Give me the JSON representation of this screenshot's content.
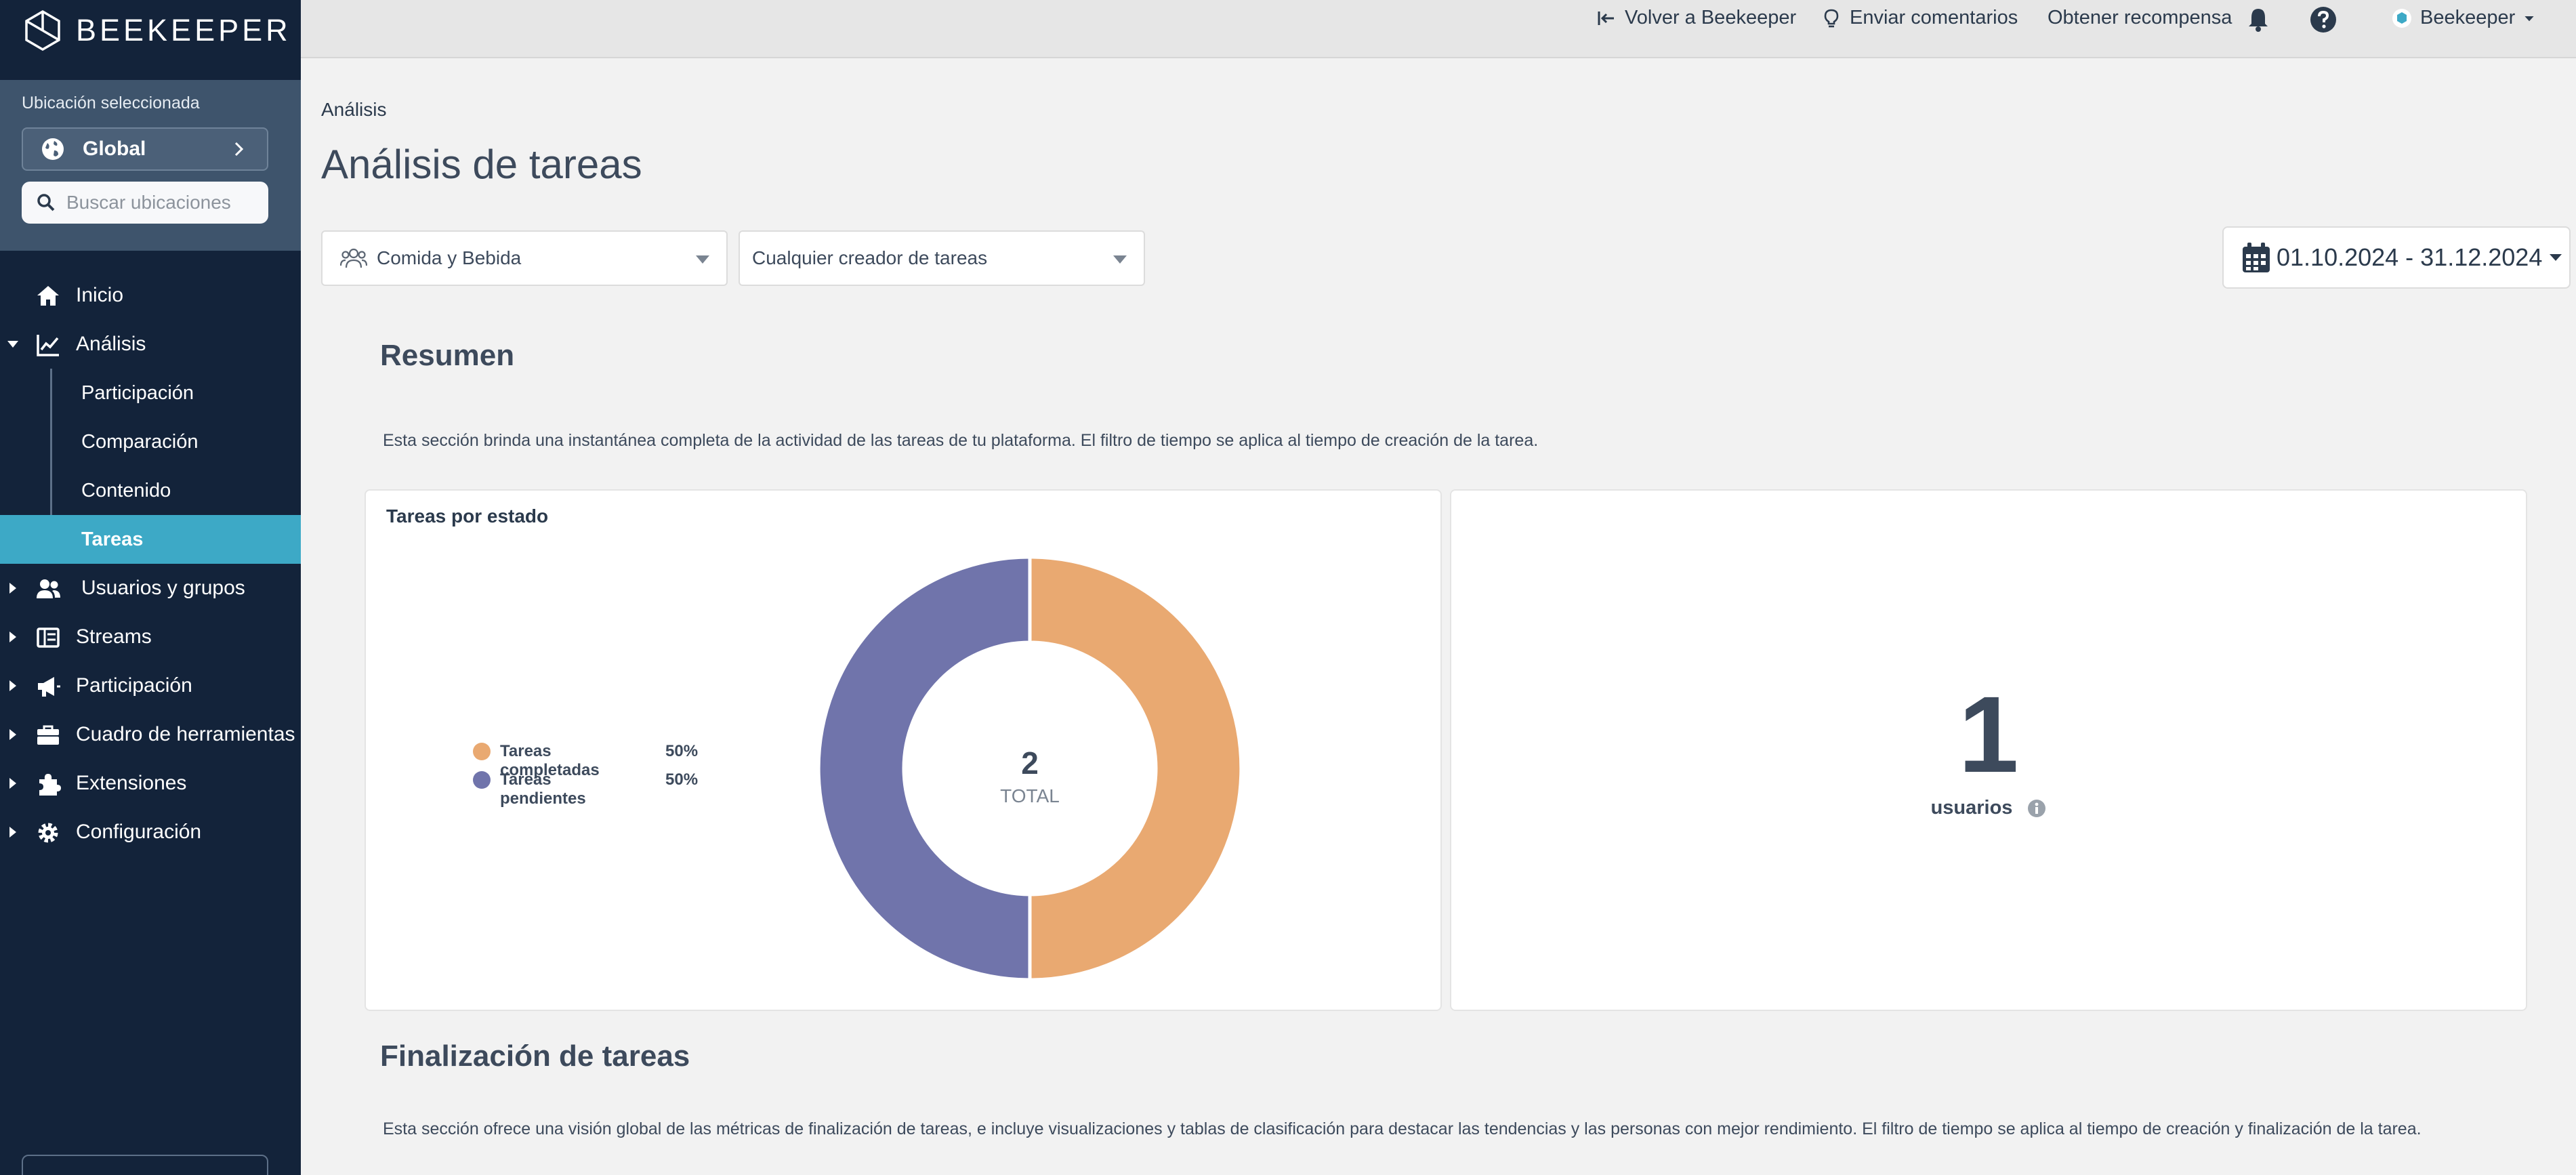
{
  "app": {
    "logo_text": "BEEKEEPER"
  },
  "sidebar": {
    "location_label": "Ubicación seleccionada",
    "location_value": "Global",
    "search_placeholder": "Buscar ubicaciones",
    "nav": [
      {
        "label": "Inicio",
        "icon": "home-icon"
      },
      {
        "label": "Análisis",
        "icon": "chart-line-icon",
        "expanded": true
      },
      {
        "label": "Usuarios y grupos",
        "icon": "users-icon"
      },
      {
        "label": "Streams",
        "icon": "streams-icon"
      },
      {
        "label": "Participación",
        "icon": "megaphone-icon"
      },
      {
        "label": "Cuadro de herramientas",
        "icon": "toolbox-icon"
      },
      {
        "label": "Extensiones",
        "icon": "puzzle-icon"
      },
      {
        "label": "Configuración",
        "icon": "gear-icon"
      }
    ],
    "analysis_sub": [
      {
        "label": "Participación"
      },
      {
        "label": "Comparación"
      },
      {
        "label": "Contenido"
      },
      {
        "label": "Tareas",
        "active": true
      }
    ]
  },
  "topbar": {
    "back_link": "Volver a Beekeeper",
    "feedback_link": "Enviar comentarios",
    "reward_link": "Obtener recompensa",
    "account_name": "Beekeeper"
  },
  "main": {
    "breadcrumb": "Análisis",
    "title": "Análisis de tareas",
    "filter_group": "Comida y Bebida",
    "filter_creator": "Cualquier creador de tareas",
    "date_range": "01.10.2024 - 31.12.2024",
    "summary": {
      "title": "Resumen",
      "description": "Esta sección brinda una instantánea completa de la actividad de las tareas de tu plataforma. El filtro de tiempo se aplica al tiempo de creación de la tarea."
    },
    "users_card": {
      "value": "1",
      "label": "usuarios"
    },
    "completion": {
      "title": "Finalización de tareas",
      "description": "Esta sección ofrece una visión global de las métricas de finalización de tareas, e incluye visualizaciones y tablas de clasificación para destacar las tendencias y las personas con mejor rendimiento. El filtro de tiempo se aplica al tiempo de creación y finalización de la tarea."
    }
  },
  "chart_data": {
    "type": "pie",
    "title": "Tareas por estado",
    "center_value": "2",
    "center_label": "TOTAL",
    "series": [
      {
        "name": "Tareas completadas",
        "value": 1,
        "percent_label": "50%",
        "color": "#e9a971"
      },
      {
        "name": "Tareas pendientes",
        "value": 1,
        "percent_label": "50%",
        "color": "#7074ab"
      }
    ],
    "legend_position": "left"
  },
  "colors": {
    "sidebar_bg": "#13233a",
    "sidebar_panel": "#3e546c",
    "active_item": "#3da9c6",
    "orange": "#e9a971",
    "purple": "#7074ab"
  }
}
